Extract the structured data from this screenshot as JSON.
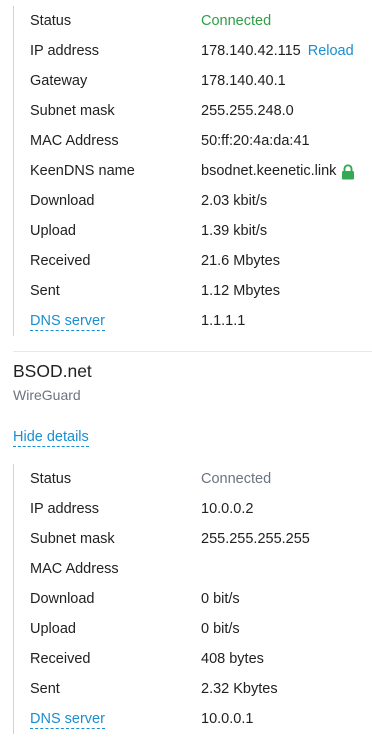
{
  "first_connection": {
    "rows": [
      {
        "label": "Status",
        "value": "Connected"
      },
      {
        "label": "IP address",
        "value": "178.140.42.115",
        "action": "Reload"
      },
      {
        "label": "Gateway",
        "value": "178.140.40.1"
      },
      {
        "label": "Subnet mask",
        "value": "255.255.248.0"
      },
      {
        "label": "MAC Address",
        "value": "50:ff:20:4a:da:41"
      },
      {
        "label": "KeenDNS name",
        "value": "bsodnet.keenetic.link",
        "icon": "lock-icon"
      },
      {
        "label": "Download",
        "value": "2.03 kbit/s"
      },
      {
        "label": "Upload",
        "value": "1.39 kbit/s"
      },
      {
        "label": "Received",
        "value": "21.6 Mbytes"
      },
      {
        "label": "Sent",
        "value": "1.12 Mbytes"
      },
      {
        "label": "DNS server",
        "value": "1.1.1.1"
      }
    ]
  },
  "second_connection": {
    "title": "BSOD.net",
    "type": "WireGuard",
    "hide_details_label": "Hide details",
    "rows": [
      {
        "label": "Status",
        "value": "Connected"
      },
      {
        "label": "IP address",
        "value": "10.0.0.2"
      },
      {
        "label": "Subnet mask",
        "value": "255.255.255.255"
      },
      {
        "label": "MAC Address",
        "value": ""
      },
      {
        "label": "Download",
        "value": "0 bit/s"
      },
      {
        "label": "Upload",
        "value": "0 bit/s"
      },
      {
        "label": "Received",
        "value": "408 bytes"
      },
      {
        "label": "Sent",
        "value": "2.32 Kbytes"
      },
      {
        "label": "DNS server",
        "value": "10.0.0.1"
      }
    ]
  },
  "colors": {
    "connected_green": "#2f9e44",
    "connected_gray": "#6b7480",
    "link_blue": "#1a8fd0",
    "lock_green": "#34a853"
  }
}
